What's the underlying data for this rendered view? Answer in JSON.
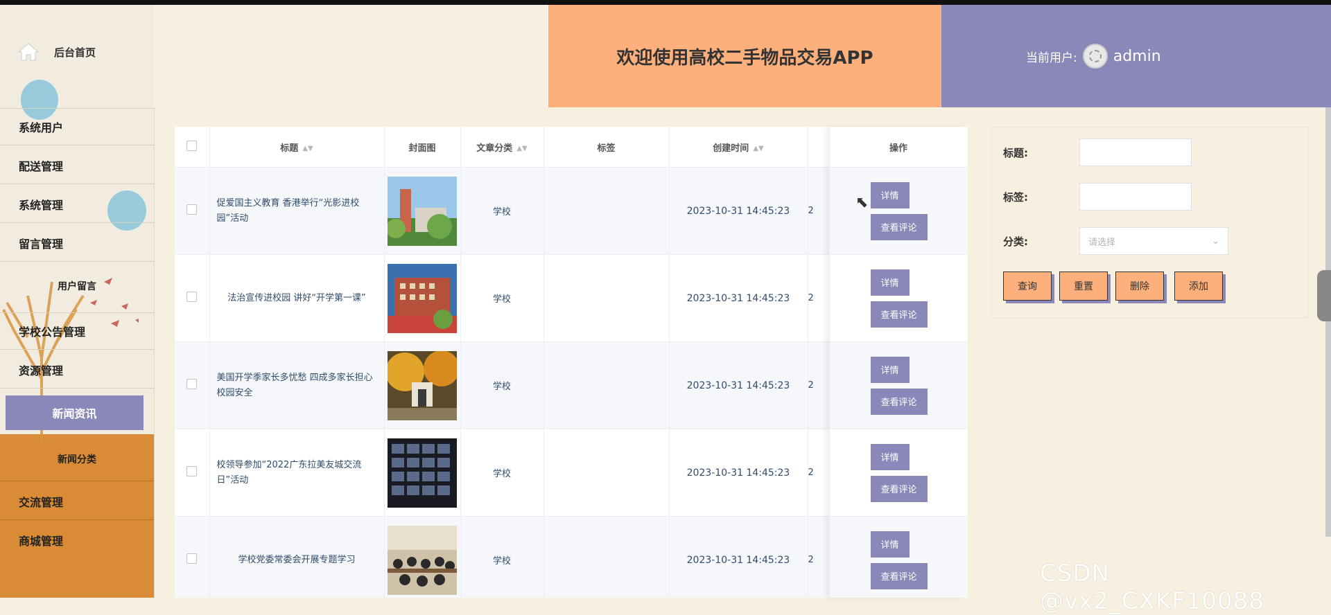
{
  "header": {
    "title": "欢迎使用高校二手物品交易APP",
    "user_label": "当前用户:",
    "username": "admin"
  },
  "sidebar": {
    "home": "后台首页",
    "items": [
      "系统用户",
      "配送管理",
      "系统管理",
      "留言管理",
      "用户留言",
      "学校公告管理",
      "资源管理",
      "新闻资讯",
      "新闻分类",
      "交流管理",
      "商城管理"
    ]
  },
  "table": {
    "columns": [
      "标题",
      "封面图",
      "文章分类",
      "标签",
      "创建时间",
      "操作"
    ],
    "rows": [
      {
        "title": "促爱国主义教育 香港举行“光影进校园”活动",
        "category": "学校",
        "tag": "",
        "created": "2023-10-31 14:45:23",
        "extra": "2"
      },
      {
        "title": "法治宣传进校园 讲好“开学第一课”",
        "category": "学校",
        "tag": "",
        "created": "2023-10-31 14:45:23",
        "extra": "2"
      },
      {
        "title": "美国开学季家长多忧愁 四成多家长担心校园安全",
        "category": "学校",
        "tag": "",
        "created": "2023-10-31 14:45:23",
        "extra": "2"
      },
      {
        "title": "校领导参加“2022广东拉美友城交流日”活动",
        "category": "学校",
        "tag": "",
        "created": "2023-10-31 14:45:23",
        "extra": "2"
      },
      {
        "title": "学校党委常委会开展专题学习",
        "category": "学校",
        "tag": "",
        "created": "2023-10-31 14:45:23",
        "extra": "2"
      }
    ],
    "detail_label": "详情",
    "comment_label": "查看评论"
  },
  "search": {
    "title_label": "标题:",
    "tag_label": "标签:",
    "category_label": "分类:",
    "category_placeholder": "请选择",
    "buttons": [
      "查询",
      "重置",
      "删除",
      "添加"
    ]
  },
  "watermark": "CSDN @vx2_CXKF10088"
}
